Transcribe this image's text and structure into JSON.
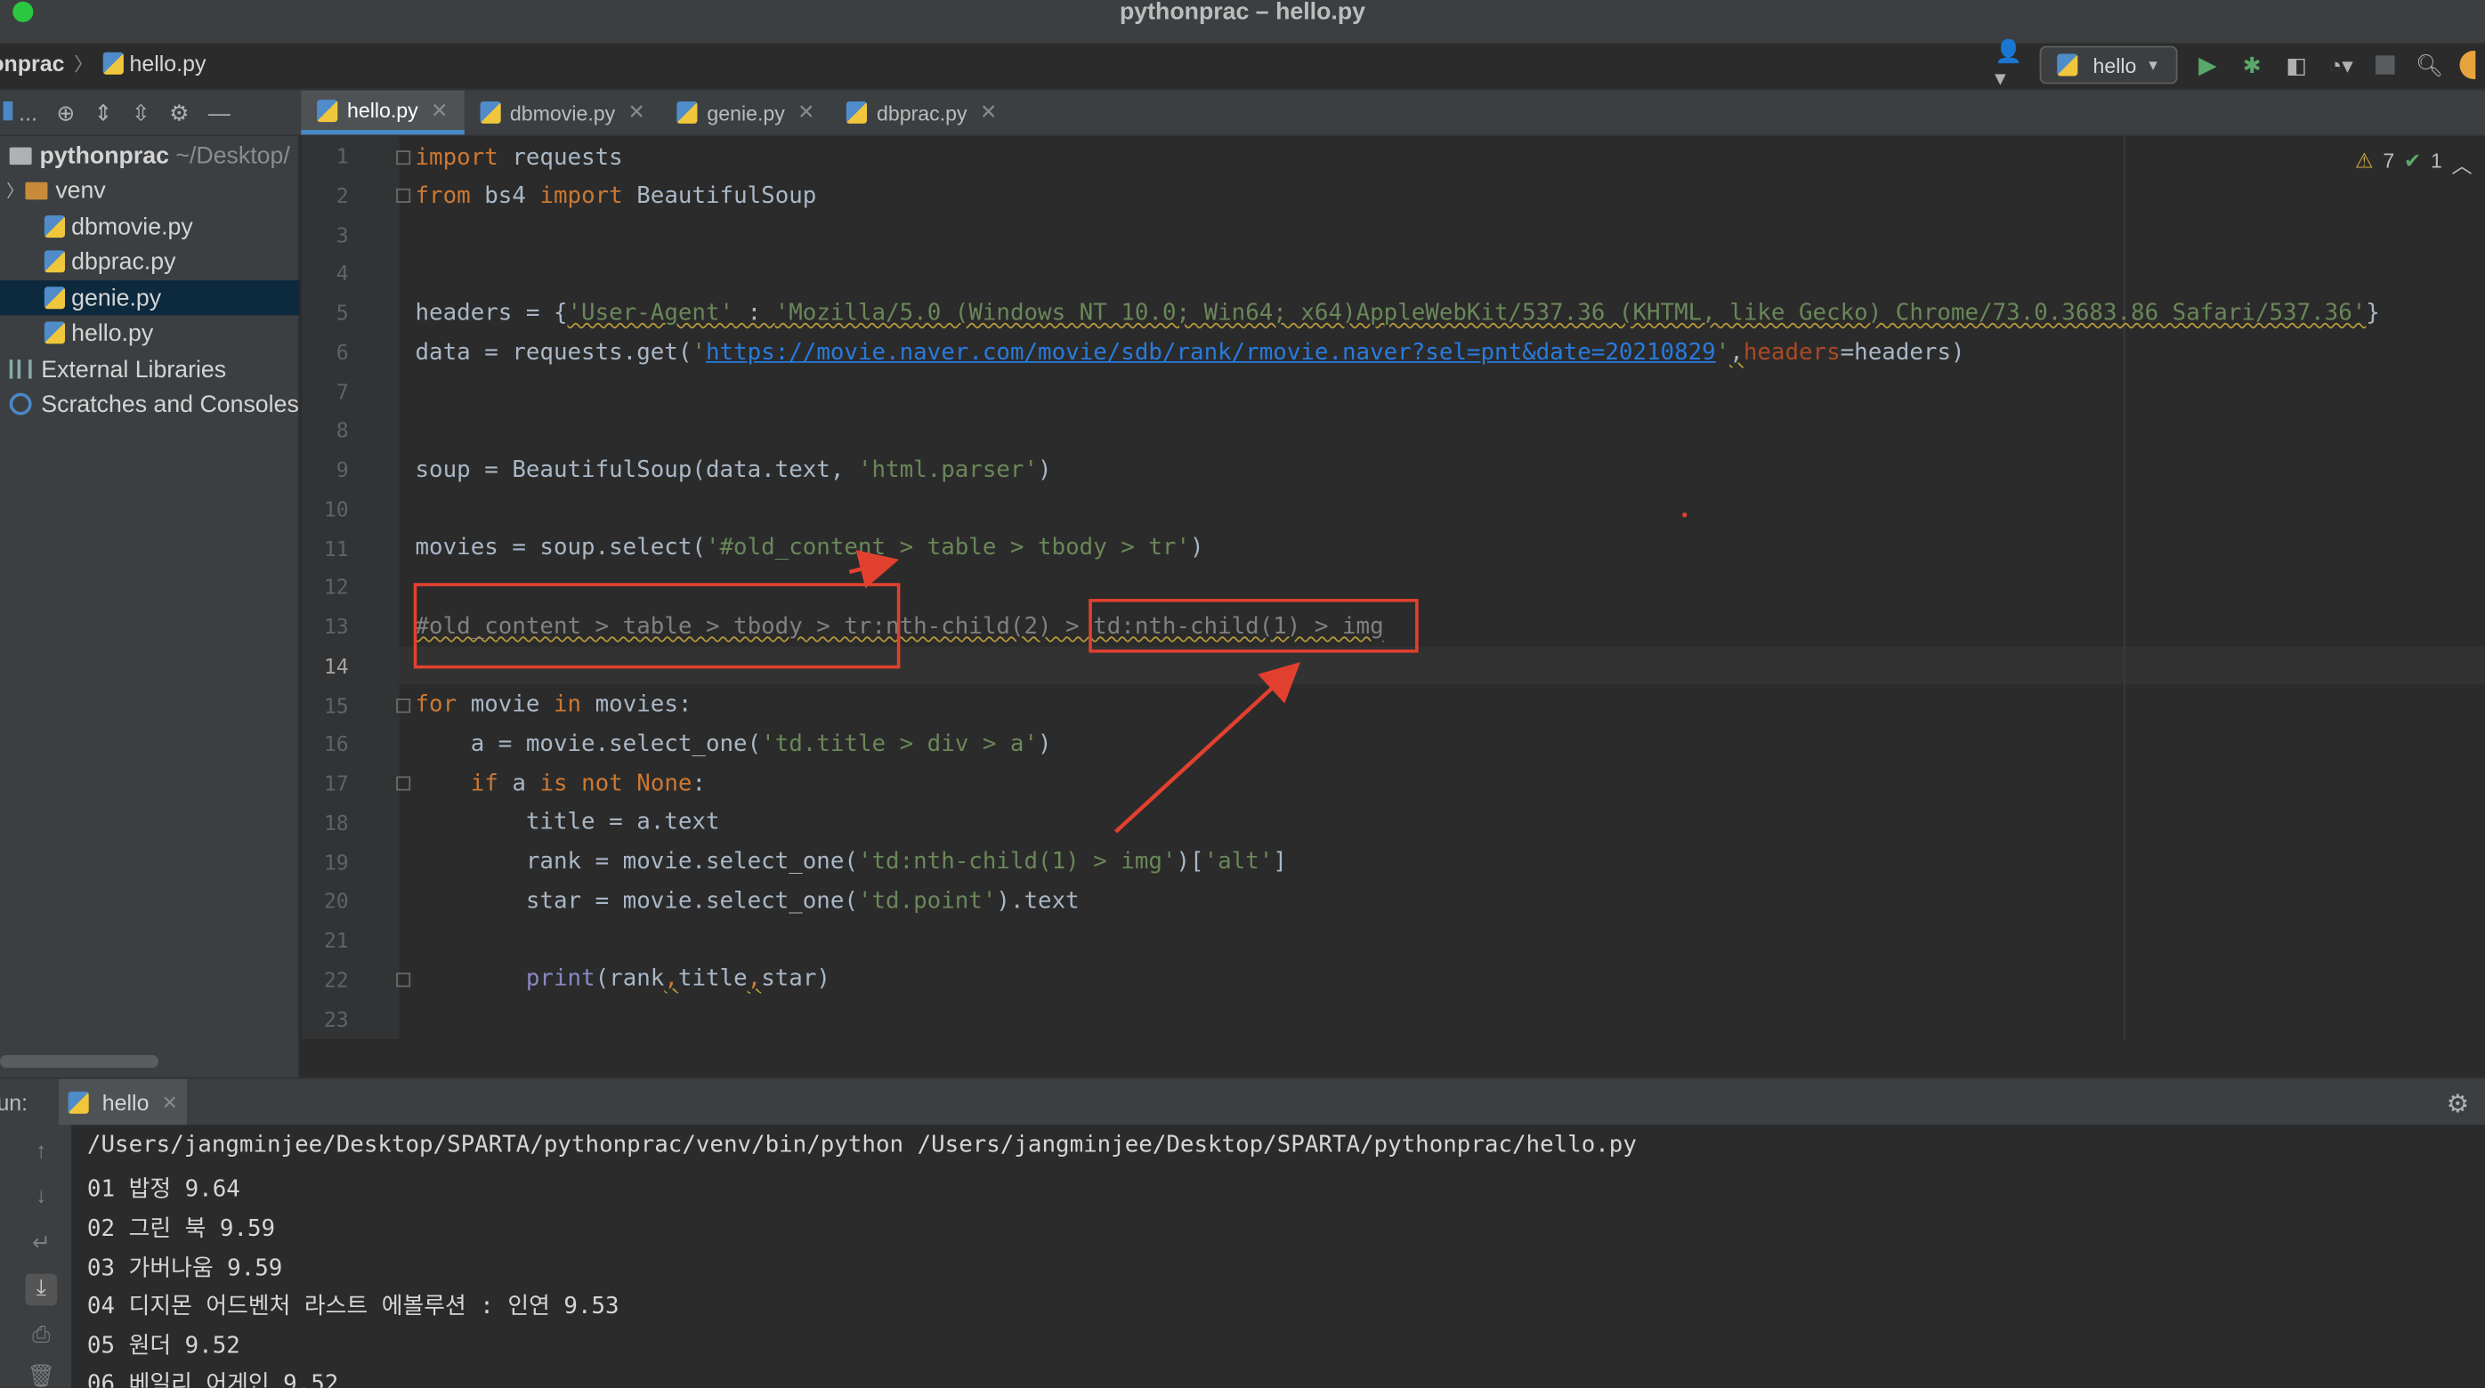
{
  "window": {
    "title": "pythonprac – hello.py"
  },
  "breadcrumb": {
    "project": "onprac",
    "file": "hello.py"
  },
  "toolbar": {
    "run_config": "hello"
  },
  "tabs": [
    {
      "label": "hello.py",
      "active": true
    },
    {
      "label": "dbmovie.py"
    },
    {
      "label": "genie.py"
    },
    {
      "label": "dbprac.py"
    }
  ],
  "project_tools": {
    "ellipsis": "..."
  },
  "tree": {
    "root_name": "pythonprac",
    "root_path": "~/Desktop/",
    "items": [
      {
        "label": "venv"
      },
      {
        "label": "dbmovie.py"
      },
      {
        "label": "dbprac.py"
      },
      {
        "label": "genie.py"
      },
      {
        "label": "hello.py"
      },
      {
        "label": "External Libraries"
      },
      {
        "label": "Scratches and Consoles"
      }
    ]
  },
  "inspections": {
    "warnings": "7",
    "ok": "1"
  },
  "line_numbers": [
    "1",
    "2",
    "3",
    "4",
    "5",
    "6",
    "7",
    "8",
    "9",
    "10",
    "11",
    "12",
    "13",
    "14",
    "15",
    "16",
    "17",
    "18",
    "19",
    "20",
    "21",
    "22",
    "23"
  ],
  "code": {
    "l1_kw": "import",
    "l1_rest": " requests",
    "l2_kw1": "from",
    "l2_mid": " bs4 ",
    "l2_kw2": "import",
    "l2_rest": " BeautifulSoup",
    "l5_a": "headers = {",
    "l5_key": "'User-Agent'",
    "l5_colon": " : ",
    "l5_val": "'Mozilla/5.0 (Windows NT 10.0; Win64; x64)AppleWebKit/537.36 (KHTML, like Gecko) Chrome/73.0.3683.86 Safari/537.36'",
    "l5_end": "}",
    "l6_a": "data = requests.get(",
    "l6_q1": "'",
    "l6_url": "https://movie.naver.com/movie/sdb/rank/rmovie.naver?sel=pnt&date=20210829",
    "l6_q2": "'",
    "l6_comma": ",",
    "l6_param": "headers",
    "l6_end": "=headers)",
    "l9_a": "soup = BeautifulSoup(data.text, ",
    "l9_str": "'html.parser'",
    "l9_end": ")",
    "l11_a": "movies = soup.select(",
    "l11_str": "'#old_content > table > tbody > tr'",
    "l11_end": ")",
    "l13": "#old_content > table > tbody > tr:nth-child(2) > td:nth-child(1) > img",
    "l15_kw1": "for",
    "l15_mid": " movie ",
    "l15_kw2": "in",
    "l15_rest": " movies:",
    "l16_a": "    a = movie.select_one(",
    "l16_str": "'td.title > div > a'",
    "l16_end": ")",
    "l17_kw1": "    if",
    "l17_mid": " a ",
    "l17_kw2": "is not None",
    "l17_end": ":",
    "l18": "        title = a.text",
    "l19_a": "        rank = movie.select_one(",
    "l19_str": "'td:nth-child(1) > img'",
    "l19_mid": ")[",
    "l19_str2": "'alt'",
    "l19_end": "]",
    "l20_a": "        star = movie.select_one(",
    "l20_str": "'td.point'",
    "l20_end": ").text",
    "l22_pre": "        ",
    "l22_fn": "print",
    "l22_a": "(rank",
    "l22_c1": ",",
    "l22_b": "title",
    "l22_c2": ",",
    "l22_c": "star)"
  },
  "run_panel": {
    "label": "un:",
    "tab": "hello",
    "output": [
      "/Users/jangminjee/Desktop/SPARTA/pythonprac/venv/bin/python /Users/jangminjee/Desktop/SPARTA/pythonprac/hello.py",
      "01 밥정 9.64",
      "02 그린 북 9.59",
      "03 가버나움 9.59",
      "04 디지몬 어드벤처 라스트 에볼루션 : 인연 9.53",
      "05 원더 9.52",
      "06 베일리 어게인 9.52"
    ]
  },
  "colors": {
    "annotation": "#e2402f",
    "accent": "#4a88c7"
  }
}
